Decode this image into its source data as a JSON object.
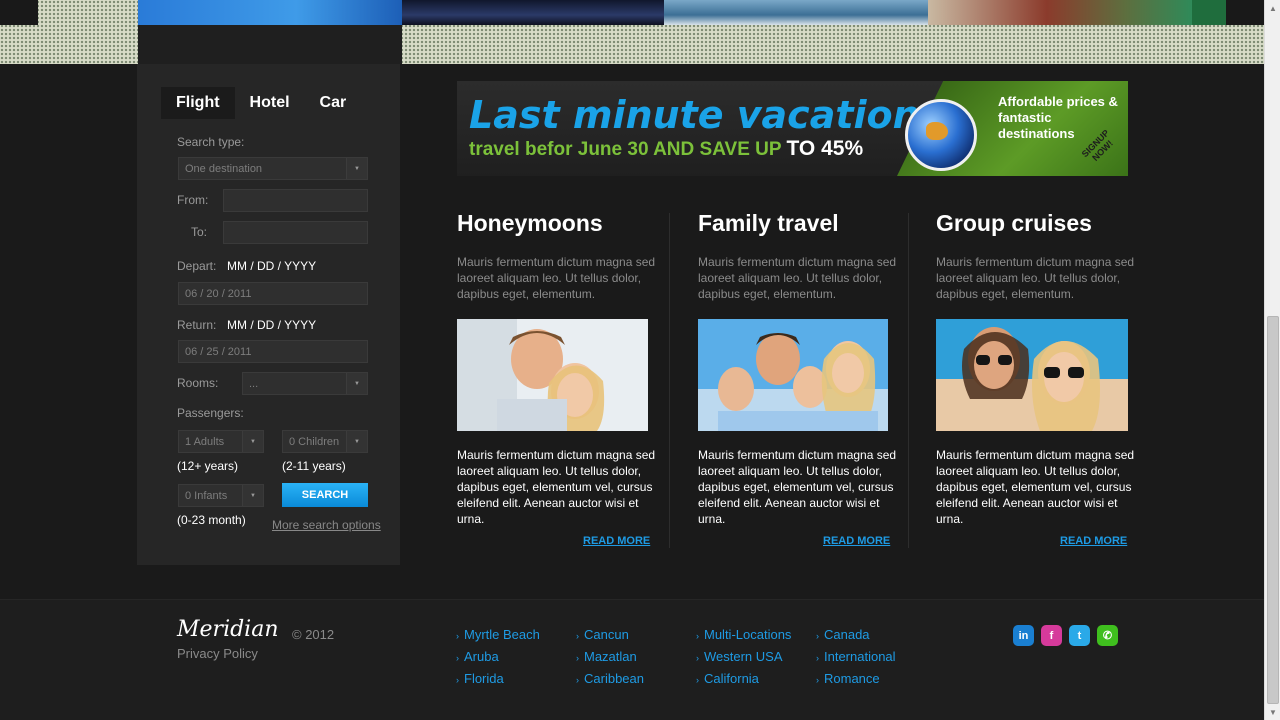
{
  "search": {
    "tabs": [
      "Flight",
      "Hotel",
      "Car"
    ],
    "search_type_label": "Search type:",
    "search_type_value": "One destination",
    "from_label": "From:",
    "to_label": "To:",
    "depart_label": "Depart:",
    "depart_format": "MM / DD / YYYY",
    "depart_value": "06 / 20 / 2011",
    "return_label": "Return:",
    "return_format": "MM / DD / YYYY",
    "return_value": "06 / 25 / 2011",
    "rooms_label": "Rooms:",
    "rooms_value": "...",
    "passengers_label": "Passengers:",
    "adults_value": "1 Adults",
    "adults_note": "(12+ years)",
    "children_value": "0 Children",
    "children_note": "(2-11 years)",
    "infants_value": "0 Infants",
    "infants_note": "(0-23 month)",
    "search_button": "SEARCH",
    "more_options": "More search options"
  },
  "banner": {
    "title": "Last minute vacation:",
    "sub_green": "travel befor June 30 AND SAVE UP",
    "sub_white": "TO 45%",
    "right_text": "Affordable prices & fantastic destinations",
    "signup": "SIGNUP NOW!"
  },
  "columns": [
    {
      "title": "Honeymoons",
      "intro": "Mauris fermentum dictum magna sed laoreet aliquam leo. Ut tellus dolor, dapibus eget, elementum.",
      "body": "Mauris fermentum dictum magna sed laoreet aliquam leo. Ut tellus dolor, dapibus eget, elementum vel, cursus eleifend elit. Aenean auctor wisi et urna.",
      "read_more": "READ MORE"
    },
    {
      "title": "Family travel",
      "intro": "Mauris fermentum dictum magna sed laoreet aliquam leo. Ut tellus dolor, dapibus eget, elementum.",
      "body": "Mauris fermentum dictum magna sed laoreet aliquam leo. Ut tellus dolor, dapibus eget, elementum vel, cursus eleifend elit. Aenean auctor wisi et urna.",
      "read_more": "READ MORE"
    },
    {
      "title": "Group cruises",
      "intro": "Mauris fermentum dictum magna sed laoreet aliquam leo. Ut tellus dolor, dapibus eget, elementum.",
      "body": "Mauris fermentum dictum magna sed laoreet aliquam leo. Ut tellus dolor, dapibus eget, elementum vel, cursus eleifend elit. Aenean auctor wisi et urna.",
      "read_more": "READ MORE"
    }
  ],
  "footer": {
    "logo": "Meridian",
    "copyright": "© 2012",
    "privacy": "Privacy Policy",
    "links": [
      [
        "Myrtle Beach",
        "Aruba",
        "Florida"
      ],
      [
        "Cancun",
        "Mazatlan",
        "Caribbean"
      ],
      [
        "Multi-Locations",
        "Western USA",
        "California"
      ],
      [
        "Canada",
        "International",
        "Romance"
      ]
    ],
    "social": [
      {
        "name": "linkedin-icon",
        "glyph": "in",
        "color": "#1a7fd1"
      },
      {
        "name": "flickr-icon",
        "glyph": "f",
        "color": "#d63a9b"
      },
      {
        "name": "twitter-icon",
        "glyph": "t",
        "color": "#2aa9e8"
      },
      {
        "name": "chat-icon",
        "glyph": "✆",
        "color": "#3fbf1e"
      }
    ]
  },
  "colors": {
    "accent": "#1e9be4",
    "panel": "#262626",
    "background": "#1a1a1a"
  }
}
